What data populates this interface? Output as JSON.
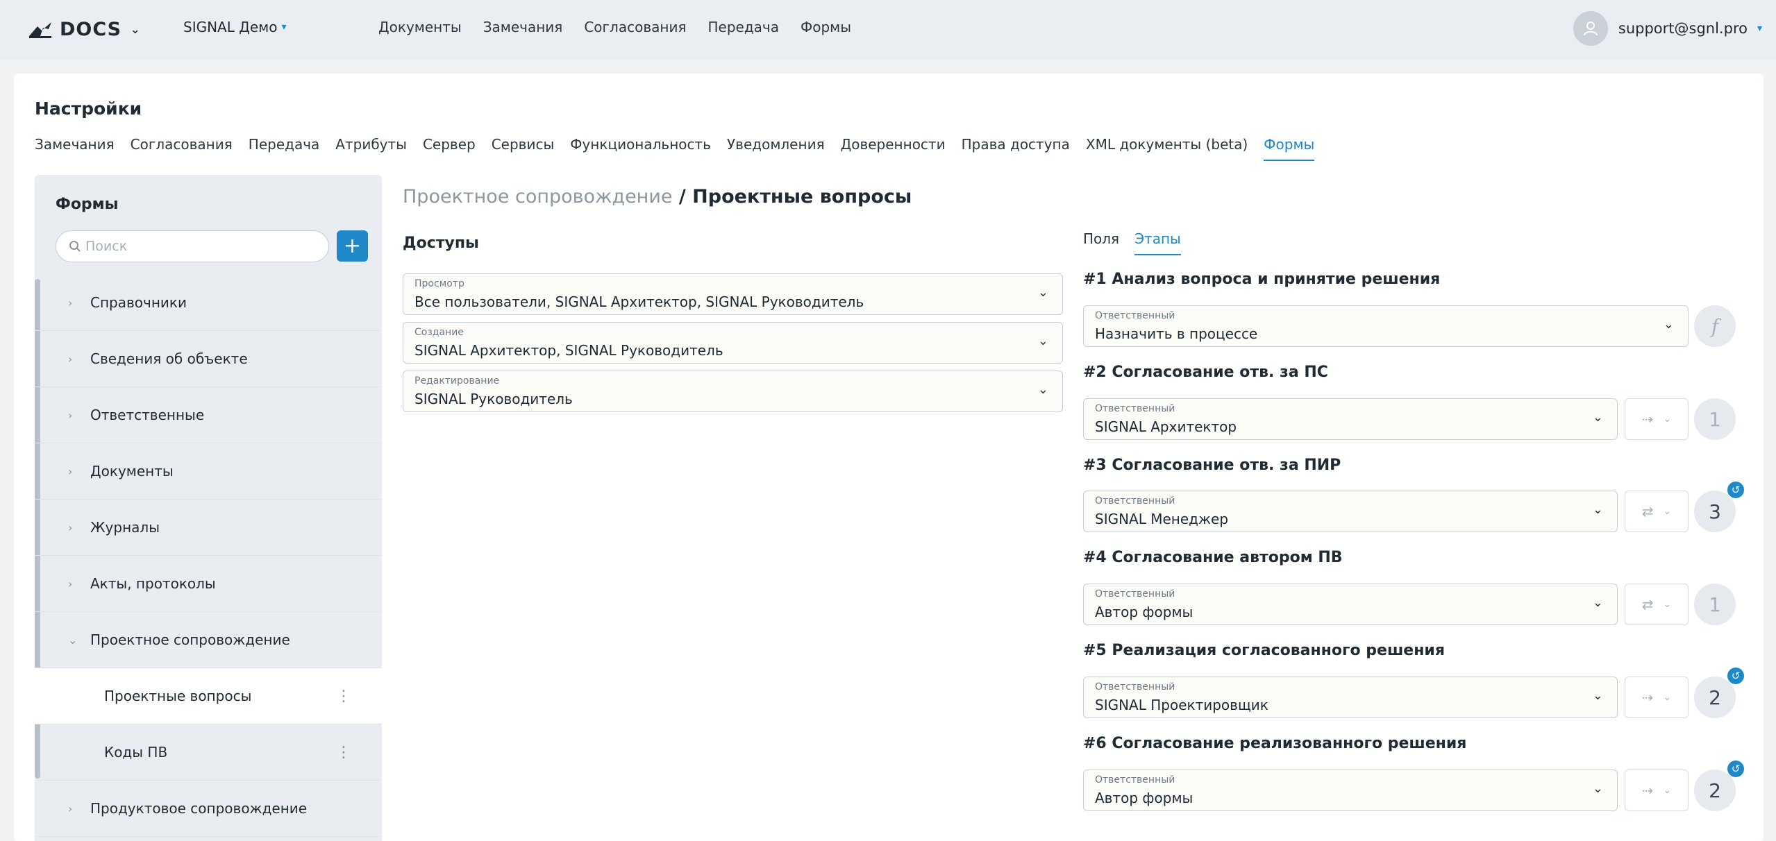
{
  "header": {
    "logo_text": "DOCS",
    "project": "SIGNAL Демо",
    "nav": [
      "Документы",
      "Замечания",
      "Согласования",
      "Передача",
      "Формы"
    ],
    "user_email": "support@sgnl.pro"
  },
  "settings": {
    "title": "Настройки",
    "tabs": [
      "Замечания",
      "Согласования",
      "Передача",
      "Атрибуты",
      "Сервер",
      "Сервисы",
      "Функциональность",
      "Уведомления",
      "Доверенности",
      "Права доступа",
      "XML документы (beta)",
      "Формы"
    ],
    "active_tab": "Формы"
  },
  "sidebar": {
    "title": "Формы",
    "search_placeholder": "Поиск",
    "add_label": "+",
    "items": [
      {
        "label": "Справочники",
        "chev": "›"
      },
      {
        "label": "Сведения об объекте",
        "chev": "›"
      },
      {
        "label": "Ответственные",
        "chev": "›"
      },
      {
        "label": "Документы",
        "chev": "›"
      },
      {
        "label": "Журналы",
        "chev": "›"
      },
      {
        "label": "Акты, протоколы",
        "chev": "›"
      },
      {
        "label": "Проектное сопровождение",
        "chev": "⌄"
      },
      {
        "label": "Проектные вопросы",
        "dots": "⋮"
      },
      {
        "label": "Коды ПВ",
        "dots": "⋮"
      },
      {
        "label": "Продуктовое сопровождение",
        "chev": "›"
      }
    ]
  },
  "main": {
    "breadcrumb_parent": "Проектное сопровождение",
    "breadcrumb_sep": " / ",
    "breadcrumb_current": "Проектные вопросы",
    "access_title": "Доступы",
    "access": [
      {
        "label": "Просмотр",
        "value": "Все пользователи, SIGNAL Архитектор, SIGNAL Руководитель"
      },
      {
        "label": "Создание",
        "value": "SIGNAL Архитектор, SIGNAL Руководитель"
      },
      {
        "label": "Редактирование",
        "value": "SIGNAL Руководитель"
      }
    ],
    "right_tabs": [
      "Поля",
      "Этапы"
    ],
    "active_right_tab": "Этапы",
    "stage_field_label": "Ответственный",
    "stages": [
      {
        "title": "#1 Анализ вопроса и принятие решения",
        "value": "Назначить в процессе",
        "round": "f"
      },
      {
        "title": "#2 Согласование отв. за ПС",
        "value": "SIGNAL Архитектор",
        "mode": "⇢",
        "round": "1"
      },
      {
        "title": "#3 Согласование отв. за ПИР",
        "value": "SIGNAL Менеджер",
        "mode": "⇄",
        "round": "3",
        "badge": "↺"
      },
      {
        "title": "#4 Согласование автором ПВ",
        "value": "Автор формы",
        "mode": "⇄",
        "round": "1"
      },
      {
        "title": "#5 Реализация согласованного решения",
        "value": "SIGNAL Проектировщик",
        "mode": "⇢",
        "round": "2",
        "badge": "↺"
      },
      {
        "title": "#6 Согласование реализованного решения",
        "value": "Автор формы",
        "mode": "⇢",
        "round": "2",
        "badge": "↺"
      }
    ]
  },
  "colors": {
    "accent": "#1e88c8",
    "topbar": "#eaeef2",
    "sidebar": "#e9edf1"
  }
}
